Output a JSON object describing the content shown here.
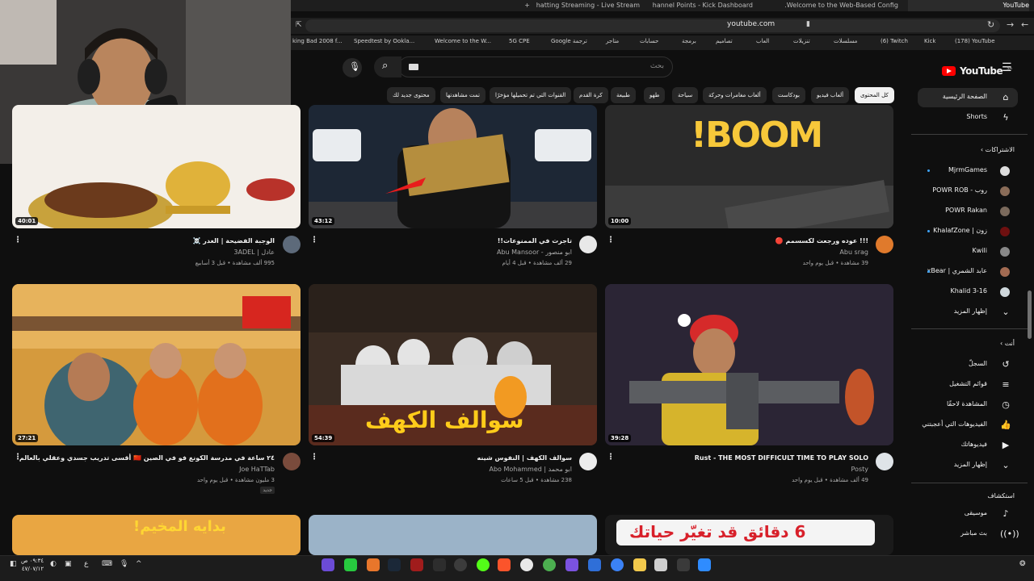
{
  "browser": {
    "tabs": [
      {
        "label": "Just Chatting Streaming - Live Stream",
        "color": "#53fc18"
      },
      {
        "label": "Channel Points - Kick Dashboard",
        "color": "#53fc18"
      },
      {
        "label": "Welcome to the Web-Based Config...",
        "color": "#9e9e9e"
      },
      {
        "label": "YouTube",
        "color": "#ff0000"
      }
    ],
    "url": "youtube.com",
    "bookmarks": [
      "king Bad 2008 f...",
      "Speedtest by Ookla...",
      "Welcome to the W...",
      "5G CPE",
      "Google ترجمة",
      "متاجر",
      "حسابات",
      "برمجة",
      "تصاميم",
      "العاب",
      "تنزيلات",
      "مسلسلات",
      "(6) Twitch",
      "Kick",
      "(178) YouTube"
    ]
  },
  "youtube": {
    "logo": "YouTube",
    "logo_country": "SA",
    "search_placeholder": "بحث",
    "chips": [
      {
        "label": "كل المحتوى",
        "selected": true
      },
      {
        "label": "ألعاب فيديو",
        "selected": false
      },
      {
        "label": "بودكاست",
        "selected": false
      },
      {
        "label": "ألعاب مغامرات وحركة",
        "selected": false
      },
      {
        "label": "سياحة",
        "selected": false
      },
      {
        "label": "طهو",
        "selected": false
      },
      {
        "label": "طبيعة",
        "selected": false
      },
      {
        "label": "كرة القدم",
        "selected": false
      },
      {
        "label": "القنوات التي تم تحميلها مؤخرًا",
        "selected": false
      },
      {
        "label": "تمت مشاهدتها",
        "selected": false
      },
      {
        "label": "محتوى جديد لك",
        "selected": false
      }
    ],
    "sidebar": {
      "home": "الصفحة الرئيسية",
      "shorts": "Shorts",
      "subscriptions_title": "الاشتراكات",
      "subscriptions": [
        {
          "label": "MjrmGames",
          "color": "#ddd"
        },
        {
          "label": "روب - POWR ROB",
          "color": "#8a6c58"
        },
        {
          "label": "POWR Rakan",
          "color": "#7b6a5c"
        },
        {
          "label": "زون | KhalafZone",
          "color": "#6e1010"
        },
        {
          "label": "Kwili",
          "color": "#888"
        },
        {
          "label": "عابد الشمري | xBear",
          "color": "#a36b52"
        },
        {
          "label": "Khalid 3-16",
          "color": "#cfd8dc"
        }
      ],
      "show_more": "إظهار المزيد",
      "you_title": "أنت",
      "you_items": [
        "السجلّ",
        "قوائم التشغيل",
        "المشاهدة لاحقًا",
        "الفيديوهات التي أعجبتني",
        "فيديوهاتك"
      ],
      "you_more": "إظهار المزيد",
      "explore_title": "استكشاف",
      "explore_items": [
        "موسيقى",
        "بث مباشر"
      ]
    },
    "videos": [
      {
        "title": "الوجبة الفضيحة | الغدر ☠️",
        "channel": "عادل | 3ADEL",
        "meta": "995 ألف مشاهدة • قبل 3 أسابيع",
        "duration": "40:01"
      },
      {
        "title": "تاجرت في الممنوعات!!",
        "channel": "ابو منصور - Abu Mansoor",
        "meta": "29 ألف مشاهدة • قبل 4 أيام",
        "duration": "43:12"
      },
      {
        "title": "!!! عوده ورجعت لكسسمم 🔴",
        "channel": "Abu srag",
        "meta": "39 مشاهدة • قبل يوم واحد",
        "duration": "10:00",
        "overlay": "BOOM!"
      },
      {
        "title": "٢٤ ساعة في مدرسة الكونغ فو في الصين 🇨🇳 أقسى تدريب جسدي وعقلي بالعالم",
        "channel": "Joe HaTTab",
        "meta": "3 مليون مشاهدة • قبل يوم واحد",
        "badge": "جديد",
        "duration": "27:21"
      },
      {
        "title": "سوالف الكهف | النفوس شينه",
        "channel": "ابو محمد | Abo Mohammed",
        "meta": "238 مشاهدة • قبل 5 ساعات",
        "duration": "54:39",
        "overlay": "سوالف الكهف"
      },
      {
        "title": "Rust - THE MOST DIFFICULT TIME TO PLAY SOLO",
        "channel": "Posty",
        "meta": "49 ألف مشاهدة • قبل يوم واحد",
        "duration": "39:28"
      }
    ],
    "bottom_overlays": [
      "بدايه المخيم!",
      "6 دقائق قد تغيّر حياتك"
    ]
  },
  "taskbar": {
    "time": "٠٩:٣٤ ص",
    "date": "٤٧/٠٧/١٢",
    "lang": "ع"
  }
}
